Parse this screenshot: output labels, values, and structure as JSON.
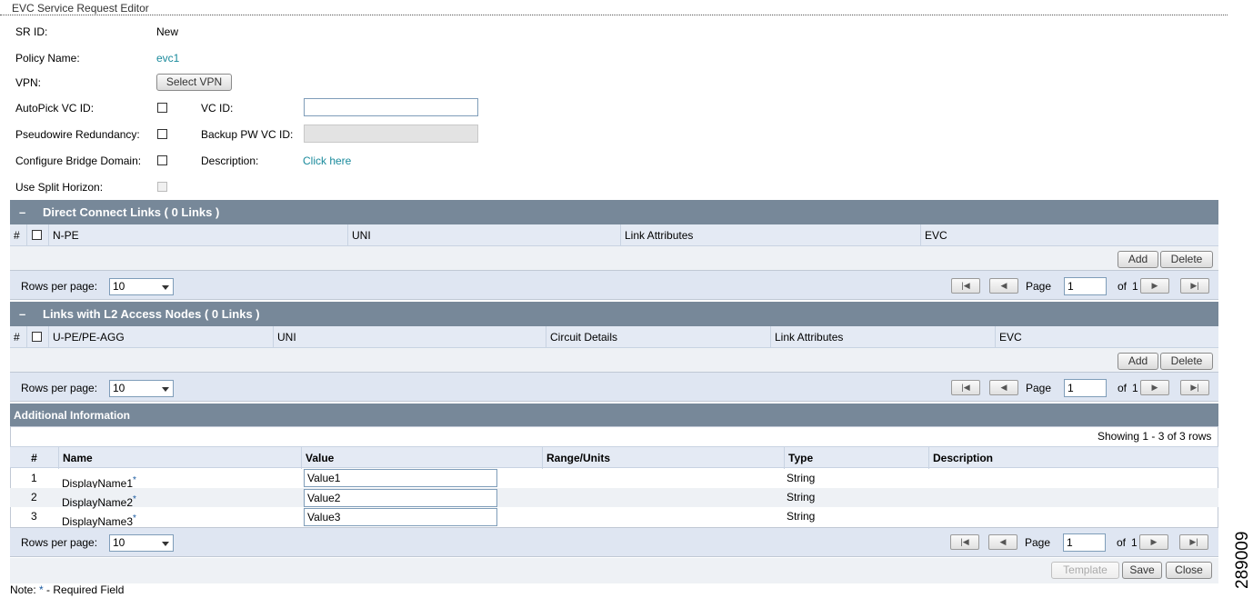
{
  "window": {
    "title": "EVC Service Request Editor"
  },
  "form": {
    "sr_id_label": "SR ID:",
    "sr_id_value": "New",
    "policy_label": "Policy Name:",
    "policy_value": "evc1",
    "vpn_label": "VPN:",
    "select_vpn_button": "Select VPN",
    "autopick_label": "AutoPick VC ID:",
    "vcid_label": "VC ID:",
    "vcid_value": "",
    "pw_redundancy_label": "Pseudowire Redundancy:",
    "backup_label": "Backup PW VC ID:",
    "backup_value": "",
    "bridge_label": "Configure Bridge Domain:",
    "description_label": "Description:",
    "description_link": "Click here",
    "split_horizon_label": "Use Split Horizon:"
  },
  "direct": {
    "toggle": "–",
    "title": "Direct Connect Links  ( 0 Links )",
    "columns": [
      "#",
      "N-PE",
      "UNI",
      "Link Attributes",
      "EVC"
    ],
    "add": "Add",
    "delete": "Delete",
    "rows_label": "Rows per page:",
    "rows_value": "10",
    "page_label": "Page",
    "page_value": "1",
    "of_label": "of",
    "total_pages": "1"
  },
  "l2": {
    "toggle": "–",
    "title": "Links with L2 Access Nodes  ( 0 Links )",
    "columns": [
      "#",
      "U-PE/PE-AGG",
      "UNI",
      "Circuit Details",
      "Link Attributes",
      "EVC"
    ],
    "add": "Add",
    "delete": "Delete",
    "rows_label": "Rows per page:",
    "rows_value": "10",
    "page_label": "Page",
    "page_value": "1",
    "of_label": "of",
    "total_pages": "1"
  },
  "additional": {
    "title": "Additional Information",
    "showing": "Showing 1 - 3 of 3 rows",
    "columns": [
      "#",
      "Name",
      "Value",
      "Range/Units",
      "Type",
      "Description"
    ],
    "rows": [
      {
        "num": "1",
        "name": "DisplayName1",
        "req": "*",
        "value": "Value1",
        "range": "",
        "type": "String",
        "desc": ""
      },
      {
        "num": "2",
        "name": "DisplayName2",
        "req": "*",
        "value": "Value2",
        "range": "",
        "type": "String",
        "desc": ""
      },
      {
        "num": "3",
        "name": "DisplayName3",
        "req": "*",
        "value": "Value3",
        "range": "",
        "type": "String",
        "desc": ""
      }
    ],
    "rows_label": "Rows per page:",
    "rows_value": "10",
    "page_label": "Page",
    "page_value": "1",
    "of_label": "of",
    "total_pages": "1"
  },
  "footer": {
    "template": "Template",
    "save": "Save",
    "close": "Close",
    "note_prefix": "Note: ",
    "note_star": "*",
    "note_suffix": " - Required Field"
  },
  "side_id": "289009",
  "colors": {
    "section_header": "#778899",
    "link": "#1a8a9c",
    "row_band": "#e4eaf4"
  }
}
